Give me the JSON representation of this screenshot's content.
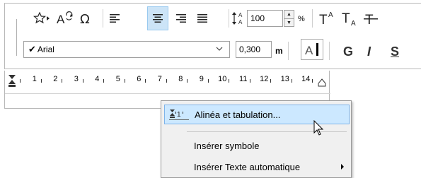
{
  "toolbar": {
    "paragraph_spacing_value": "100",
    "paragraph_spacing_unit": "%",
    "font_name": "Arial",
    "font_size_value": "0,300",
    "font_size_unit": "m",
    "bold_letter": "G",
    "italic_letter": "I",
    "underline_letter": "S",
    "icons": [
      "favorite-arrow-icon",
      "text-replace-icon",
      "omega-icon",
      "align-left-icon",
      "align-center-icon",
      "align-right-icon",
      "align-justify-icon",
      "line-spacing-icon",
      "superscript-icon",
      "subscript-icon",
      "strikethrough-icon",
      "highlight-color-icon",
      "font-color-icon"
    ],
    "active_alignment": "center"
  },
  "ruler": {
    "numbers": [
      "1",
      "2",
      "3",
      "4",
      "5",
      "6",
      "7",
      "8",
      "9",
      "10",
      "11",
      "12",
      "13",
      "14"
    ]
  },
  "context_menu": {
    "items": [
      {
        "label": "Alinéa et tabulation...",
        "highlighted": true,
        "icon": "indent-tab-icon"
      },
      {
        "label": "Insérer symbole",
        "highlighted": false
      },
      {
        "label": "Insérer Texte automatique",
        "highlighted": false,
        "submenu": true
      }
    ]
  }
}
